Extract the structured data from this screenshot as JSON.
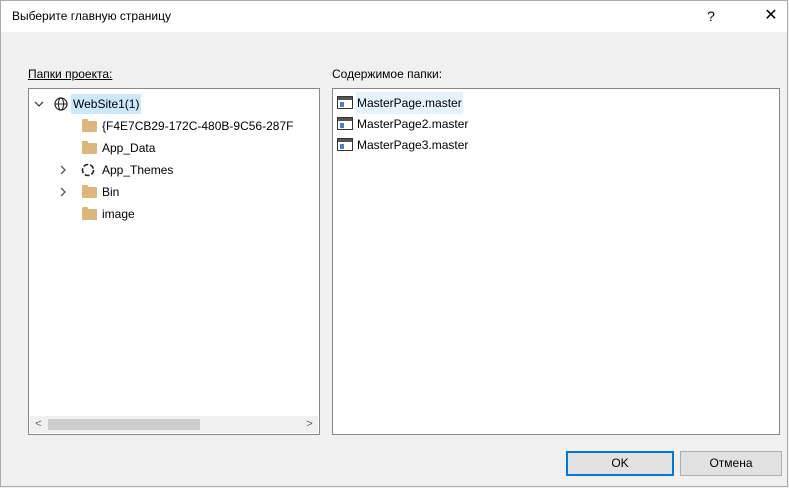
{
  "window": {
    "title": "Выберите главную страницу",
    "help_label": "?",
    "close_label": "✕"
  },
  "folders_label": "Папки проекта:",
  "contents_label": "Содержимое папки:",
  "tree": [
    {
      "label": "WebSite1(1)",
      "icon": "globe-icon",
      "expander": "expanded"
    },
    {
      "label": "{F4E7CB29-172C-480B-9C56-287F",
      "icon": "folder-icon",
      "expander": "none"
    },
    {
      "label": "App_Data",
      "icon": "folder-icon",
      "expander": "none"
    },
    {
      "label": "App_Themes",
      "icon": "themes-icon",
      "expander": "collapsed"
    },
    {
      "label": "Bin",
      "icon": "folder-icon",
      "expander": "collapsed"
    },
    {
      "label": "image",
      "icon": "folder-icon",
      "expander": "none"
    }
  ],
  "files": [
    {
      "name": "MasterPage.master",
      "icon": "master-page-icon",
      "selected": true
    },
    {
      "name": "MasterPage2.master",
      "icon": "master-page-icon",
      "selected": false
    },
    {
      "name": "MasterPage3.master",
      "icon": "master-page-icon",
      "selected": false
    }
  ],
  "scrollbar": {
    "left_arrow": "<",
    "right_arrow": ">"
  },
  "buttons": {
    "ok": "OK",
    "cancel": "Отмена"
  },
  "colors": {
    "accent": "#0078d7",
    "selection": "#cce8ff",
    "folder": "#dcb67a"
  }
}
